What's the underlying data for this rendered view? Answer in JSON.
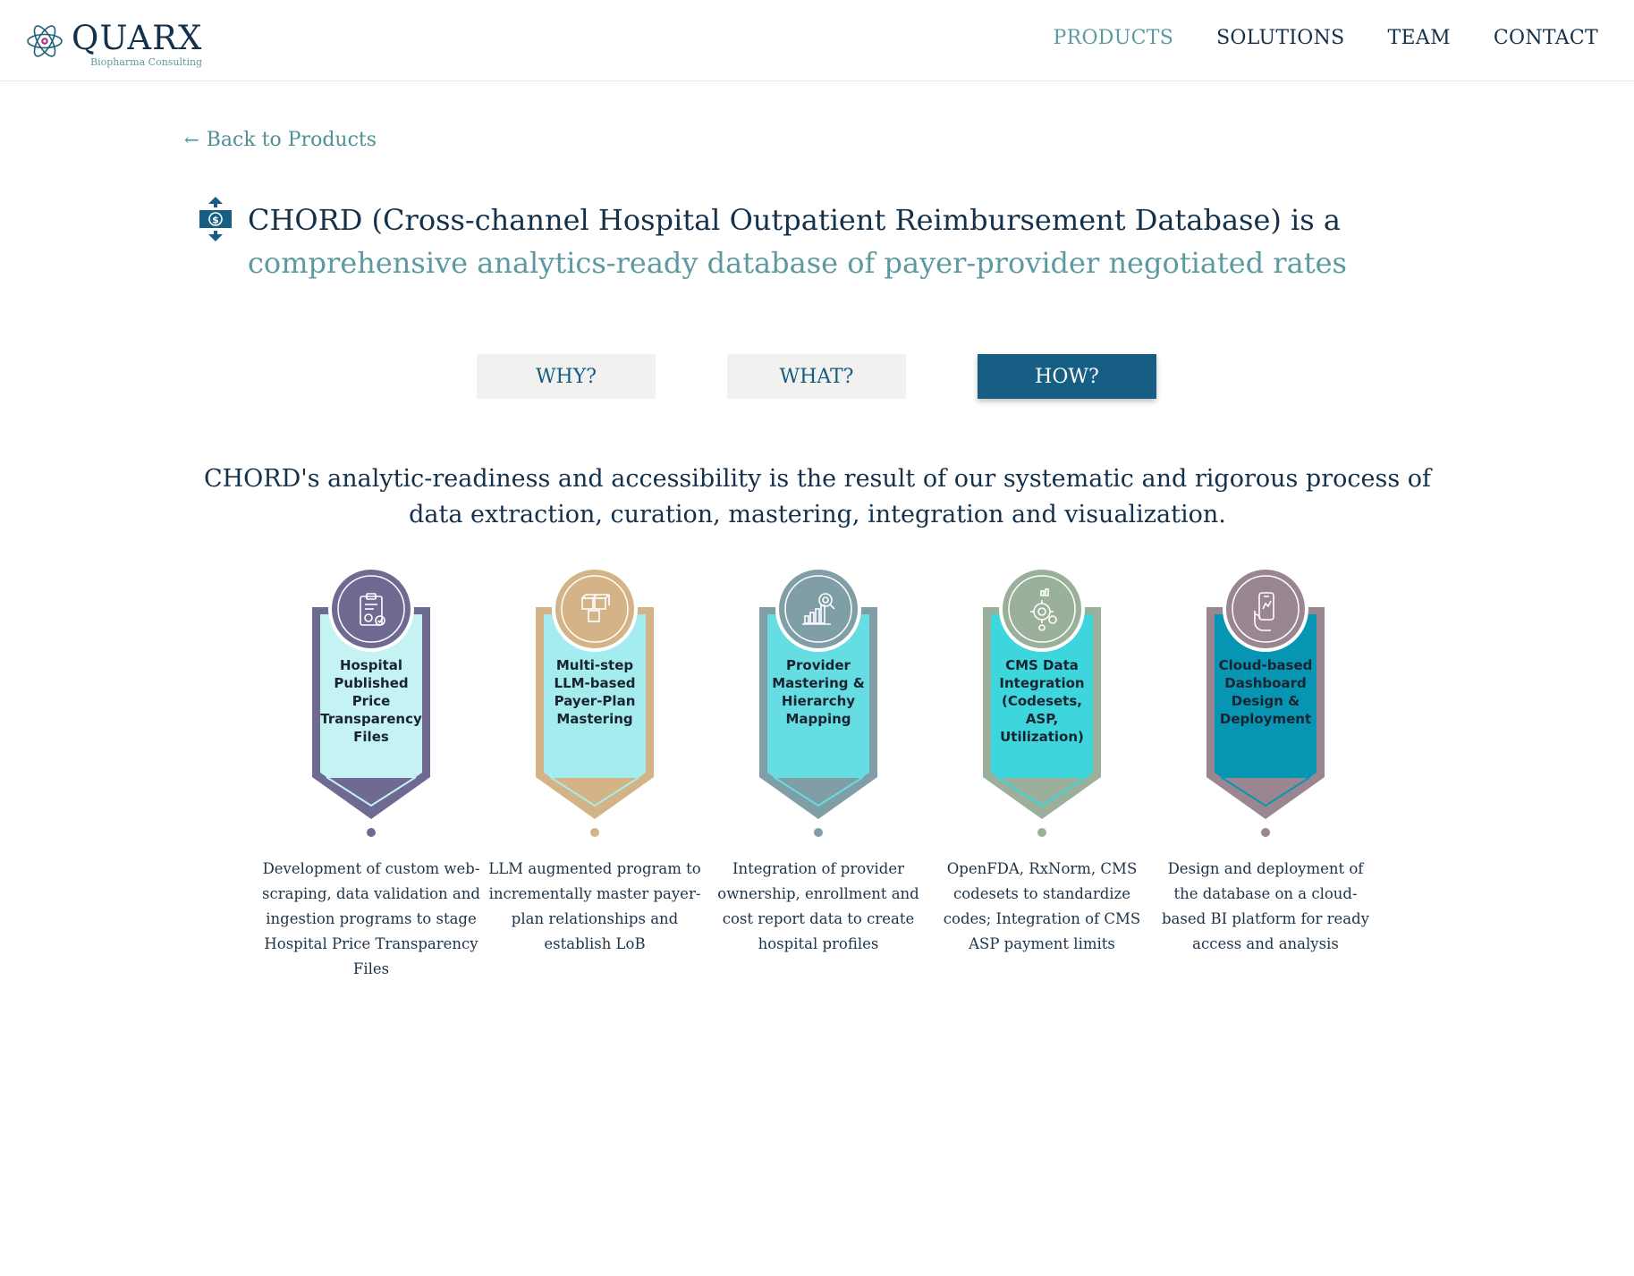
{
  "brand": {
    "name": "QUARX",
    "tagline": "Biopharma Consulting"
  },
  "nav": {
    "items": [
      {
        "label": "PRODUCTS",
        "active": true
      },
      {
        "label": "SOLUTIONS",
        "active": false
      },
      {
        "label": "TEAM",
        "active": false
      },
      {
        "label": "CONTACT",
        "active": false
      }
    ]
  },
  "back_link": "Back to Products",
  "title": {
    "line1": "CHORD (Cross-channel Hospital Outpatient Reimbursement Database) is a",
    "line2": "comprehensive analytics-ready database of payer-provider negotiated rates"
  },
  "tabs": [
    {
      "label": "WHY?",
      "active": false
    },
    {
      "label": "WHAT?",
      "active": false
    },
    {
      "label": "HOW?",
      "active": true
    }
  ],
  "intro": "CHORD's analytic-readiness and accessibility is the result of our systematic and rigorous process of data extraction, curation, mastering, integration and visualization.",
  "steps": [
    {
      "label": "Hospital Published Price Transparency Files",
      "description": "Development of custom web-scraping, data validation and ingestion programs to stage Hospital Price Transparency Files",
      "icon": "clipboard-settings-icon",
      "frame_color": "#6f6a92",
      "fill_color": "#c5f2f3"
    },
    {
      "label": "Multi-step LLM-based Payer-Plan Mastering",
      "description": "LLM augmented program to incrementally master payer-plan relationships and establish LoB",
      "icon": "boxes-icon",
      "frame_color": "#d4b487",
      "fill_color": "#a4ecee"
    },
    {
      "label": "Provider Mastering & Hierarchy Mapping",
      "description": "Integration of provider ownership, enrollment and cost report data to create hospital profiles",
      "icon": "chart-magnifier-icon",
      "frame_color": "#7f9ea6",
      "fill_color": "#66dde3"
    },
    {
      "label": "CMS Data Integration (Codesets, ASP, Utilization)",
      "description": "OpenFDA, RxNorm, CMS codesets to standardize codes; Integration of CMS ASP payment limits",
      "icon": "gear-network-icon",
      "frame_color": "#9bb09a",
      "fill_color": "#3dd6dd"
    },
    {
      "label": "Cloud-based Dashboard Design & Deployment",
      "description": "Design and deployment of the database on a cloud-based BI platform for ready access and analysis",
      "icon": "phone-hand-icon",
      "frame_color": "#9a8690",
      "fill_color": "#0696b3"
    }
  ]
}
